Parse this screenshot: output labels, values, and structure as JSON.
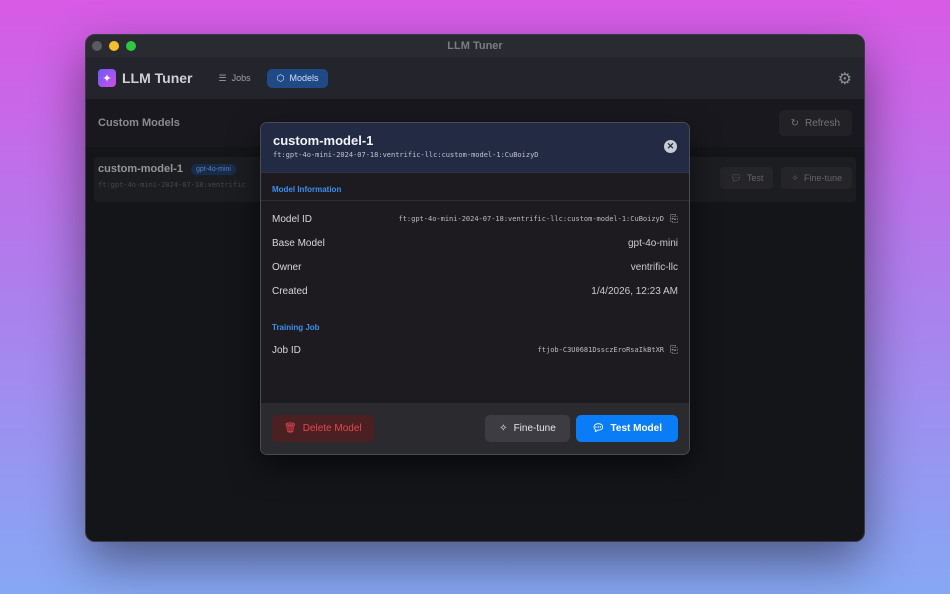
{
  "window": {
    "title": "LLM Tuner"
  },
  "app": {
    "name": "LLM Tuner"
  },
  "nav": {
    "tabs": [
      {
        "label": "Jobs",
        "icon": "list-icon"
      },
      {
        "label": "Models",
        "icon": "cube-icon",
        "active": true
      }
    ]
  },
  "page": {
    "title": "Custom Models",
    "refresh_label": "Refresh"
  },
  "list": {
    "items": [
      {
        "name": "custom-model-1",
        "badge": "gpt-4o-mini",
        "id_preview": "ft:gpt-4o-mini-2024-07-18:ventrific",
        "test_label": "Test",
        "finetune_label": "Fine-tune"
      }
    ]
  },
  "modal": {
    "title": "custom-model-1",
    "subtitle": "ft:gpt-4o-mini-2024-07-18:ventrific-llc:custom-model-1:CuBoizyD",
    "sections": {
      "model_info": {
        "title": "Model Information",
        "rows": [
          {
            "label": "Model ID",
            "value": "ft:gpt-4o-mini-2024-07-18:ventrific-llc:custom-model-1:CuBoizyD"
          },
          {
            "label": "Base Model",
            "value": "gpt-4o-mini"
          },
          {
            "label": "Owner",
            "value": "ventrific-llc"
          },
          {
            "label": "Created",
            "value": "1/4/2026, 12:23 AM"
          }
        ]
      },
      "training_job": {
        "title": "Training Job",
        "rows": [
          {
            "label": "Job ID",
            "value": "ftjob-C3U0681DssczEroRsaIkBtXR"
          }
        ]
      }
    },
    "footer": {
      "delete_label": "Delete Model",
      "finetune_label": "Fine-tune",
      "test_label": "Test Model"
    }
  },
  "colors": {
    "accent": "#0a7cf6",
    "danger": "#e5484d",
    "section_title": "#3d8ff0"
  }
}
